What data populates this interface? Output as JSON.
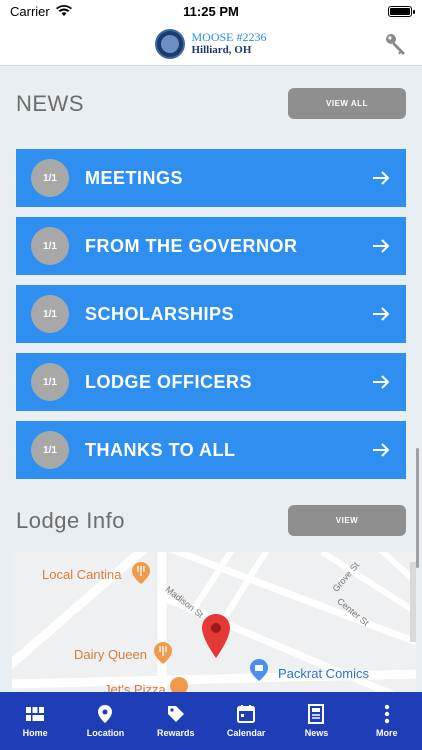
{
  "status": {
    "carrier": "Carrier",
    "time": "11:25 PM"
  },
  "header": {
    "title_top": "MOOSE #2236",
    "title_bottom": "Hilliard, OH"
  },
  "news": {
    "title": "NEWS",
    "view_all_label": "VIEW ALL",
    "items": [
      {
        "count": "1/1",
        "label": "MEETINGS"
      },
      {
        "count": "1/1",
        "label": "FROM THE GOVERNOR"
      },
      {
        "count": "1/1",
        "label": "SCHOLARSHIPS"
      },
      {
        "count": "1/1",
        "label": "LODGE OFFICERS"
      },
      {
        "count": "1/1",
        "label": "THANKS TO ALL"
      }
    ]
  },
  "lodge": {
    "title": "Lodge Info",
    "view_label": "VIEW"
  },
  "map": {
    "pois": {
      "cantina": "Local Cantina",
      "dairy": "Dairy Queen",
      "comics": "Packrat Comics",
      "pizza": "Jet's Pizza"
    },
    "streets": {
      "madison": "Madison St",
      "grove": "Grove St",
      "center": "Center St"
    }
  },
  "tabs": [
    {
      "label": "Home",
      "icon": "home-grid-icon"
    },
    {
      "label": "Location",
      "icon": "location-pin-icon"
    },
    {
      "label": "Rewards",
      "icon": "tag-icon"
    },
    {
      "label": "Calendar",
      "icon": "calendar-icon"
    },
    {
      "label": "News",
      "icon": "newspaper-icon"
    },
    {
      "label": "More",
      "icon": "more-vertical-icon"
    }
  ],
  "colors": {
    "accent": "#2f8ff0",
    "tabbar": "#1e3eb8",
    "button": "#8f8f8f"
  }
}
